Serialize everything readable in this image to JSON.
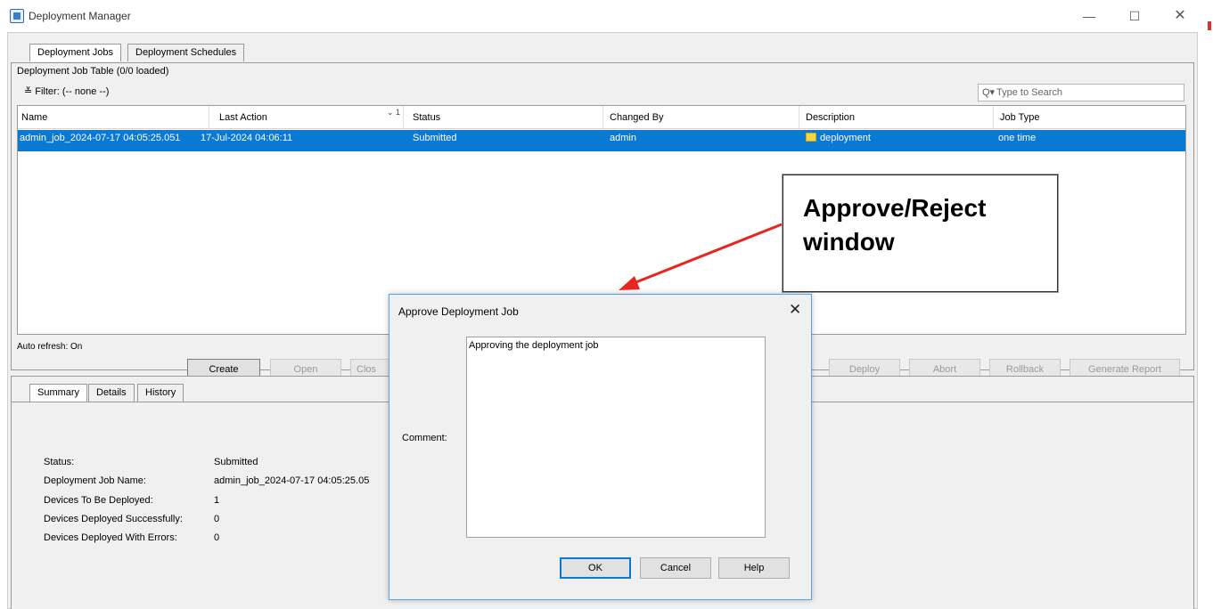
{
  "window": {
    "title": "Deployment Manager",
    "min_glyph": "—",
    "max_glyph": "☐",
    "close_glyph": "✕"
  },
  "top_tabs": [
    "Deployment Jobs",
    "Deployment Schedules"
  ],
  "table": {
    "title": "Deployment Job Table (0/0 loaded)",
    "filter": "≚ Filter: (-- none --)",
    "search_placeholder": "Type to Search",
    "search_icon": "search-icon",
    "sort_indicator": "⌄ 1",
    "columns": [
      "Name",
      "Last Action",
      "Status",
      "Changed By",
      "Description",
      "Job Type"
    ],
    "rows": [
      {
        "name": "admin_job_2024-07-17 04:05:25.051",
        "last_action": "17-Jul-2024 04:06:11",
        "status": "Submitted",
        "changed_by": "admin",
        "description": "deployment",
        "job_type": "one time"
      }
    ],
    "selected_row_color": "#0a79d4"
  },
  "auto_refresh": "Auto refresh: On",
  "buttons": {
    "create": "Create",
    "open": "Open",
    "close_job": "Clos",
    "deploy": "Deploy",
    "abort": "Abort",
    "rollback": "Rollback",
    "generate_report": "Generate Report"
  },
  "bottom_tabs": [
    "Summary",
    "Details",
    "History"
  ],
  "summary": [
    {
      "label": "Status:",
      "value": "Submitted"
    },
    {
      "label": "Deployment Job Name:",
      "value": "admin_job_2024-07-17 04:05:25.05"
    },
    {
      "label": "Devices To Be Deployed:",
      "value": "1"
    },
    {
      "label": "Devices Deployed Successfully:",
      "value": "0"
    },
    {
      "label": "Devices Deployed With Errors:",
      "value": "0"
    }
  ],
  "annotation": {
    "line1": "Approve/Reject",
    "line2": "window",
    "arrow_color": "#e8261f"
  },
  "dialog": {
    "title": "Approve Deployment Job",
    "close_glyph": "✕",
    "comment_label": "Comment:",
    "comment_value": "Approving the deployment job",
    "ok": "OK",
    "cancel": "Cancel",
    "help": "Help"
  }
}
